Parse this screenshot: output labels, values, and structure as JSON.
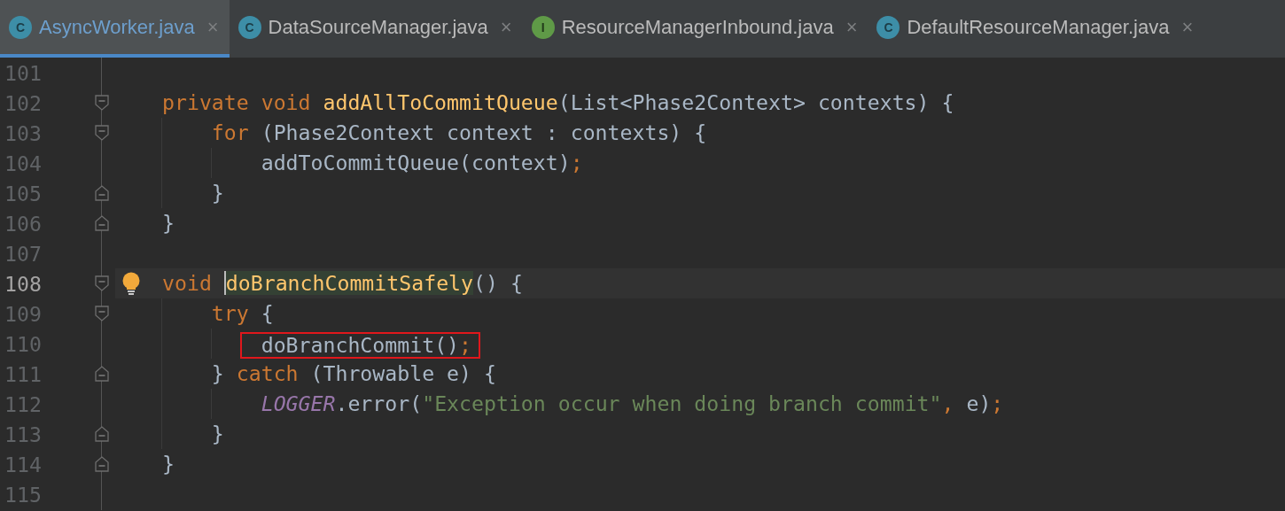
{
  "tabs": [
    {
      "icon": "C",
      "kind": "class",
      "label": "AsyncWorker.java",
      "close": "×",
      "selected": true
    },
    {
      "icon": "C",
      "kind": "class",
      "label": "DataSourceManager.java",
      "close": "×",
      "selected": false
    },
    {
      "icon": "I",
      "kind": "interface",
      "label": "ResourceManagerInbound.java",
      "close": "×",
      "selected": false
    },
    {
      "icon": "C",
      "kind": "class",
      "label": "DefaultResourceManager.java",
      "close": "×",
      "selected": false
    }
  ],
  "editor": {
    "lines": [
      {
        "number": "101",
        "current": false
      },
      {
        "number": "102",
        "current": false,
        "fold_open": true,
        "tokens": [
          {
            "text": "private void ",
            "kind": "keyword"
          },
          {
            "text": "addAllToCommitQueue",
            "kind": "decl"
          },
          {
            "text": "(List<Phase2Context> contexts) {",
            "kind": "plain"
          }
        ]
      },
      {
        "number": "103",
        "current": false,
        "fold_open": true,
        "tokens": [
          {
            "text": "    for ",
            "kind": "keyword"
          },
          {
            "text": "(Phase2Context context : contexts) {",
            "kind": "plain"
          }
        ]
      },
      {
        "number": "104",
        "current": false,
        "tokens": [
          {
            "text": "        addToCommitQueue(context)",
            "kind": "plain"
          },
          {
            "text": ";",
            "kind": "punct"
          }
        ]
      },
      {
        "number": "105",
        "current": false,
        "fold_close": true,
        "tokens": [
          {
            "text": "    }",
            "kind": "plain"
          }
        ]
      },
      {
        "number": "106",
        "current": false,
        "fold_close": true,
        "tokens": [
          {
            "text": "}",
            "kind": "plain"
          }
        ]
      },
      {
        "number": "107",
        "current": false
      },
      {
        "number": "108",
        "current": true,
        "fold_open": true,
        "intention": true,
        "tokens": [
          {
            "text": "void ",
            "kind": "keyword"
          },
          {
            "text": "doBranchCommitSafely",
            "kind": "decl",
            "highlighted": true,
            "caret": true
          },
          {
            "text": "() {",
            "kind": "plain"
          }
        ]
      },
      {
        "number": "109",
        "current": false,
        "fold_open": true,
        "tokens": [
          {
            "text": "    try ",
            "kind": "keyword"
          },
          {
            "text": "{",
            "kind": "plain"
          }
        ]
      },
      {
        "number": "110",
        "current": false,
        "tokens": [
          {
            "kind": "group",
            "boxed": true,
            "tokens": [
              {
                "text": "        doBranchCommit()",
                "kind": "plain"
              },
              {
                "text": ";",
                "kind": "punct"
              }
            ]
          }
        ]
      },
      {
        "number": "111",
        "current": false,
        "fold_close": true,
        "tokens": [
          {
            "text": "    } ",
            "kind": "plain"
          },
          {
            "text": "catch ",
            "kind": "keyword"
          },
          {
            "text": "(Throwable e) {",
            "kind": "plain"
          }
        ]
      },
      {
        "number": "112",
        "current": false,
        "tokens": [
          {
            "text": "        LOGGER",
            "kind": "constant"
          },
          {
            "text": ".error(",
            "kind": "plain"
          },
          {
            "text": "\"Exception occur when doing branch commit\"",
            "kind": "string"
          },
          {
            "text": ", ",
            "kind": "punct"
          },
          {
            "text": "e)",
            "kind": "plain"
          },
          {
            "text": ";",
            "kind": "punct"
          }
        ]
      },
      {
        "number": "113",
        "current": false,
        "fold_close": true,
        "tokens": [
          {
            "text": "    }",
            "kind": "plain"
          }
        ]
      },
      {
        "number": "114",
        "current": false,
        "fold_close": true,
        "tokens": [
          {
            "text": "}",
            "kind": "plain"
          }
        ]
      },
      {
        "number": "115",
        "current": false
      }
    ]
  }
}
